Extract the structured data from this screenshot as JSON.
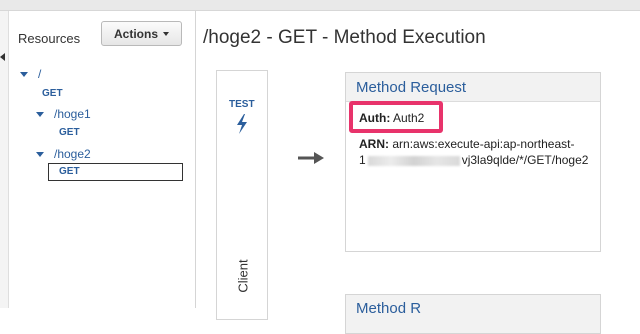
{
  "resources": {
    "title": "Resources",
    "actions_label": "Actions",
    "tree": [
      {
        "path": "/",
        "methods": [
          "GET"
        ]
      },
      {
        "path": "/hoge1",
        "methods": [
          "GET"
        ]
      },
      {
        "path": "/hoge2",
        "methods": [
          "GET"
        ],
        "selected_method": "GET"
      }
    ]
  },
  "main": {
    "title": "/hoge2 - GET - Method Execution",
    "client": {
      "test_label": "TEST",
      "label": "Client"
    },
    "method_request": {
      "title": "Method Request",
      "auth_label": "Auth:",
      "auth_value": "Auth2",
      "arn_label": "ARN:",
      "arn_value_line1": "arn:aws:execute-api:ap-northeast-",
      "arn_value_line2_prefix": "1",
      "arn_value_line2_suffix": "vj3la9qlde/*/GET/hoge2"
    },
    "method_response": {
      "title": "Method R"
    }
  },
  "colors": {
    "link_blue": "#2b5e9c",
    "highlight": "#e8336b"
  }
}
